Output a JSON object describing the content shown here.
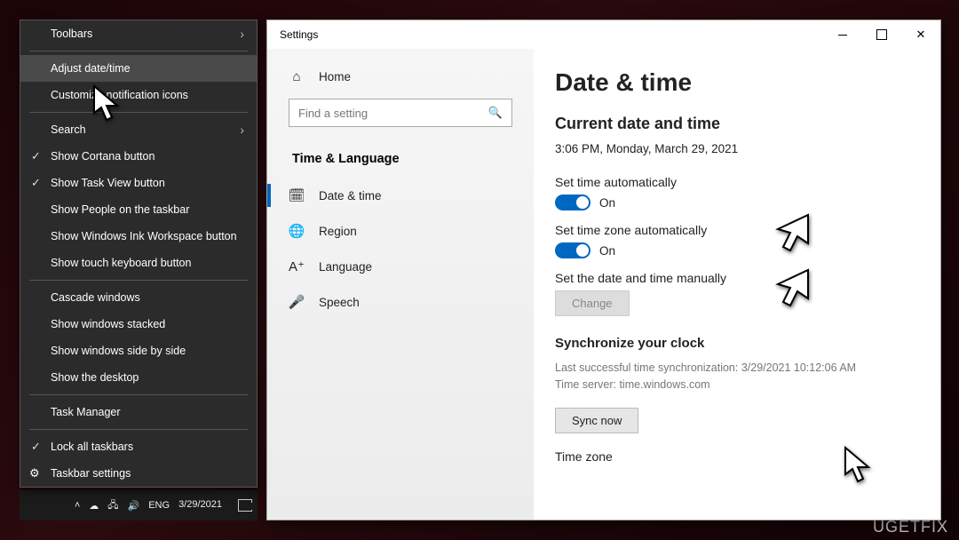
{
  "context_menu": {
    "toolbars": "Toolbars",
    "adjust": "Adjust date/time",
    "customize": "Customize notification icons",
    "search": "Search",
    "cortana": "Show Cortana button",
    "taskview": "Show Task View button",
    "people": "Show People on the taskbar",
    "ink": "Show Windows Ink Workspace button",
    "touchkb": "Show touch keyboard button",
    "cascade": "Cascade windows",
    "stacked": "Show windows stacked",
    "sidebyside": "Show windows side by side",
    "desktop": "Show the desktop",
    "taskmgr": "Task Manager",
    "lock": "Lock all taskbars",
    "tbsettings": "Taskbar settings"
  },
  "taskbar": {
    "lang": "ENG",
    "date": "3/29/2021"
  },
  "settings": {
    "title": "Settings",
    "home": "Home",
    "search_placeholder": "Find a setting",
    "category": "Time & Language",
    "nav": {
      "datetime": "Date & time",
      "region": "Region",
      "language": "Language",
      "speech": "Speech"
    },
    "page": {
      "heading": "Date & time",
      "current_label": "Current date and time",
      "current_value": "3:06 PM, Monday, March 29, 2021",
      "auto_time": "Set time automatically",
      "auto_time_state": "On",
      "auto_tz": "Set time zone automatically",
      "auto_tz_state": "On",
      "manual": "Set the date and time manually",
      "change": "Change",
      "sync_head": "Synchronize your clock",
      "sync_last": "Last successful time synchronization: 3/29/2021 10:12:06 AM",
      "sync_server": "Time server: time.windows.com",
      "sync_btn": "Sync now",
      "timezone": "Time zone"
    }
  },
  "watermark": "UGETFIX"
}
